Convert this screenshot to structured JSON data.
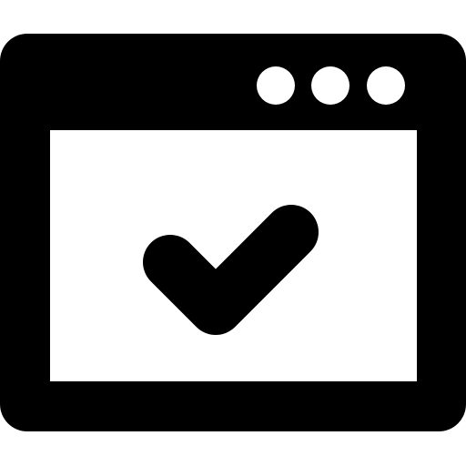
{
  "icon": {
    "name": "browser-window-check-icon",
    "foreground": "#000000",
    "background": "#ffffff",
    "window_dots": [
      "dot-1",
      "dot-2",
      "dot-3"
    ],
    "content_symbol": "checkmark-icon"
  }
}
